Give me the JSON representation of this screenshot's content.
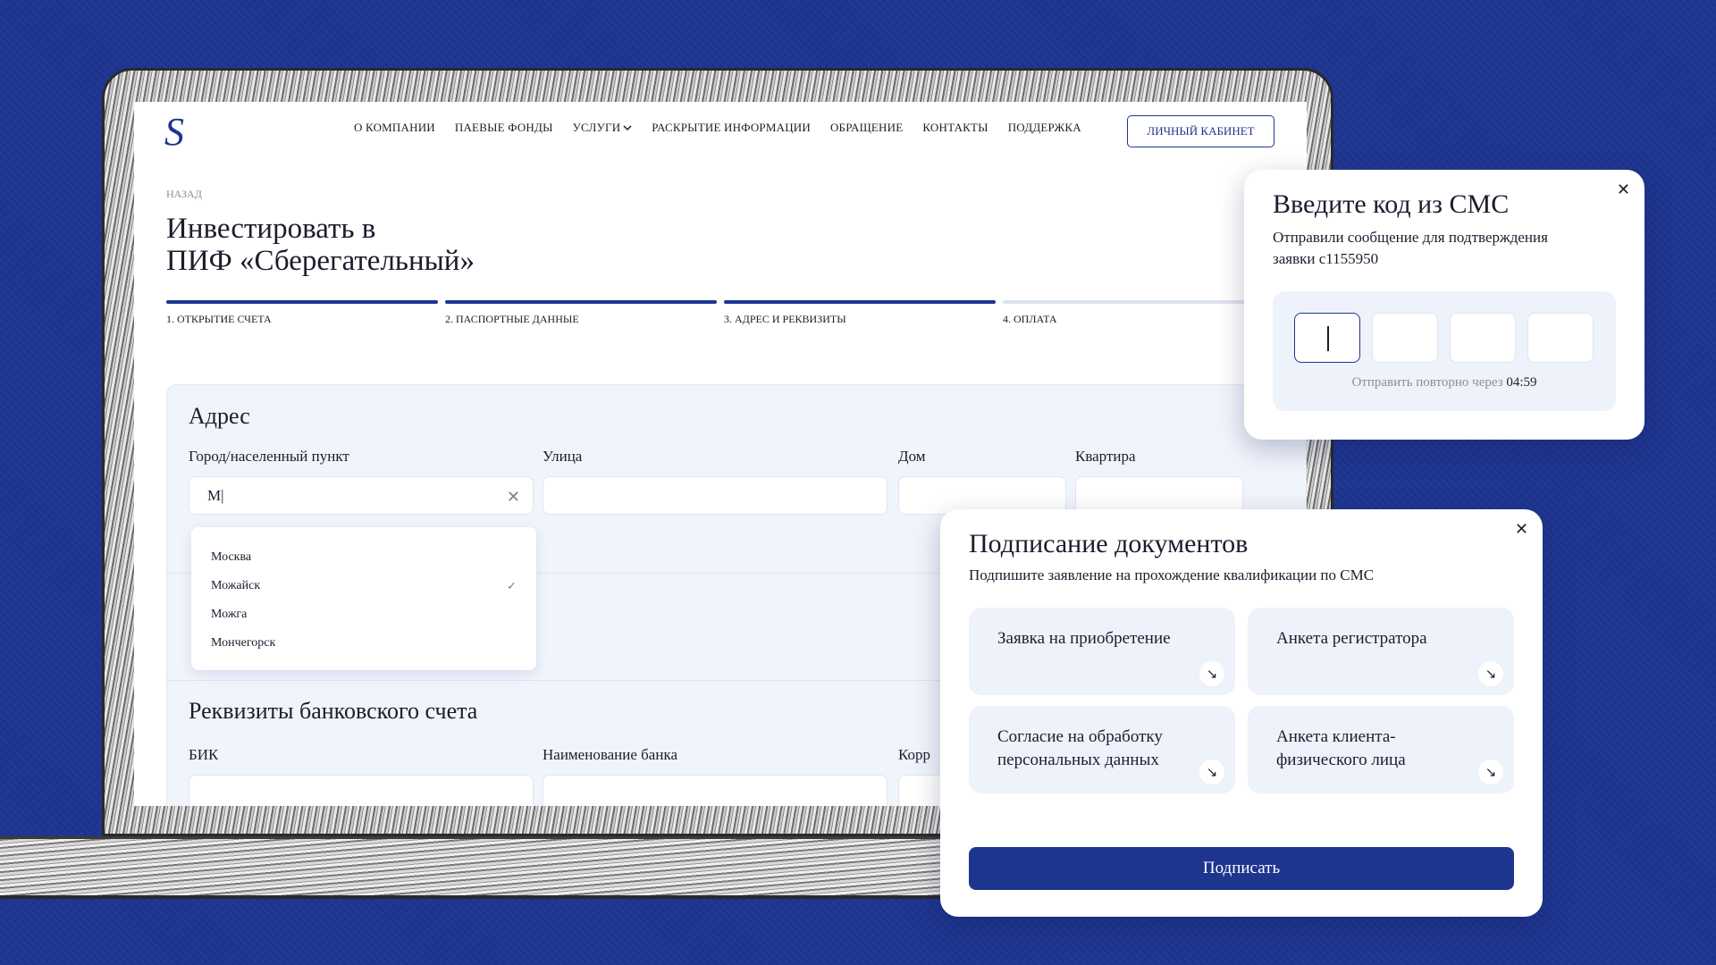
{
  "logo": {
    "glyph": "S"
  },
  "nav": {
    "items": [
      {
        "label": "О компании"
      },
      {
        "label": "Паевые фонды"
      },
      {
        "label": "Услуги",
        "has_dropdown": true
      },
      {
        "label": "Раскрытие информации"
      },
      {
        "label": "Обращение"
      },
      {
        "label": "Контакты"
      },
      {
        "label": "Поддержка"
      }
    ],
    "cabinet": "Личный кабинет"
  },
  "back": "Назад",
  "title_line1": "Инвестировать в",
  "title_line2": "ПИФ «Сберегательный»",
  "steps": [
    {
      "label": "1. Открытие счета",
      "done": true
    },
    {
      "label": "2. Паспортные данные",
      "done": true
    },
    {
      "label": "3. Адрес и реквизиты",
      "done": true
    },
    {
      "label": "4. Оплата",
      "done": false
    }
  ],
  "address": {
    "title": "Адрес",
    "city_label": "Город/населенный пункт",
    "city_value": "М|",
    "street_label": "Улица",
    "house_label": "Дом",
    "apt_label": "Квартира"
  },
  "city_options": [
    {
      "label": "Москва",
      "selected": false
    },
    {
      "label": "Можайск",
      "selected": true
    },
    {
      "label": "Можга",
      "selected": false
    },
    {
      "label": "Мончегорск",
      "selected": false
    }
  ],
  "bank": {
    "title": "Реквизиты банковского счета",
    "bik_label": "БИК",
    "bank_name_label": "Наименование банка",
    "corr_label": "Корр"
  },
  "sms_modal": {
    "title": "Введите код из СМС",
    "subtitle_line1": "Отправили сообщение для подтверждения",
    "subtitle_line2": "заявки c1155950",
    "resend_text": "Отправить повторно через",
    "timer": "04:59"
  },
  "sign_modal": {
    "title": "Подписание документов",
    "subtitle": "Подпишите заявление на прохождение квалификации по СМС",
    "docs": [
      {
        "line1": "Заявка на приобретение",
        "line2": ""
      },
      {
        "line1": "Анкета регистратора",
        "line2": ""
      },
      {
        "line1": "Согласие на обработку",
        "line2": "персональных данных"
      },
      {
        "line1": "Анкета клиента-",
        "line2": "физического лица"
      }
    ],
    "button": "Подписать"
  },
  "colors": {
    "brand": "#1e3590",
    "card_bg": "#eef2fa",
    "muted": "#8d8d98"
  },
  "icons": {
    "close": "close-icon",
    "check": "check-icon",
    "arrow": "arrow-down-right-icon",
    "chevron": "chevron-down-icon"
  }
}
